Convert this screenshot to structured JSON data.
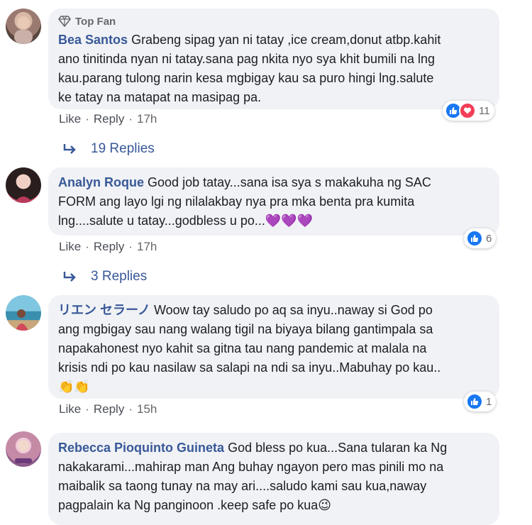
{
  "comments": [
    {
      "badge": "Top Fan",
      "author": "Bea Santos",
      "lines": [
        "Grabeng sipag yan ni tatay ,ice cream,donut atbp.kahit",
        "ano tinitinda nyan ni tatay.sana pag nkita nyo sya khit bumili na lng",
        "kau.parang tulong narin kesa mgbigay kau sa puro hingi lng.salute",
        "ke tatay na matapat na masipag pa."
      ],
      "like": "Like",
      "reply": "Reply",
      "time": "17h",
      "reaction_count": "11",
      "reaction_types": [
        "like",
        "love"
      ],
      "replies_label": "19 Replies"
    },
    {
      "author": "Analyn Roque",
      "lines": [
        "Good job tatay...sana isa sya s makakuha ng SAC",
        "FORM ang layo lgi ng nilalakbay nya pra mka benta pra kumita",
        "lng....salute u tatay...godbless u po..."
      ],
      "emoji": "💜💜💜",
      "like": "Like",
      "reply": "Reply",
      "time": "17h",
      "reaction_count": "6",
      "reaction_types": [
        "like"
      ],
      "replies_label": "3 Replies"
    },
    {
      "author": "リエン セラーノ",
      "lines": [
        "Woow tay saludo po aq sa inyu..naway si God po",
        "ang mgbigay sau nang walang tigil na biyaya bilang gantimpala sa",
        "napakahonest nyo kahit sa gitna tau nang pandemic at malala na",
        "krisis ndi po kau nasilaw sa salapi na ndi sa inyu..Mabuhay po kau.."
      ],
      "emoji": "👏👏",
      "like": "Like",
      "reply": "Reply",
      "time": "15h",
      "reaction_count": "1",
      "reaction_types": [
        "like"
      ]
    },
    {
      "author": "Rebecca Pioquinto Guineta",
      "lines": [
        "God bless po kua...Sana tularan ka Ng",
        "nakakarami...mahirap man Ang buhay ngayon pero mas pinili mo na",
        "maibalik sa taong tunay na may ari....saludo kami sau kua,naway",
        "pagpalain ka Ng panginoon .keep safe po kua"
      ],
      "emoji": "😉"
    }
  ],
  "colors": {
    "author": "#385898",
    "bubble": "#f0f2f5",
    "like_blue": "#1877f2",
    "love_red": "#f33e58"
  }
}
